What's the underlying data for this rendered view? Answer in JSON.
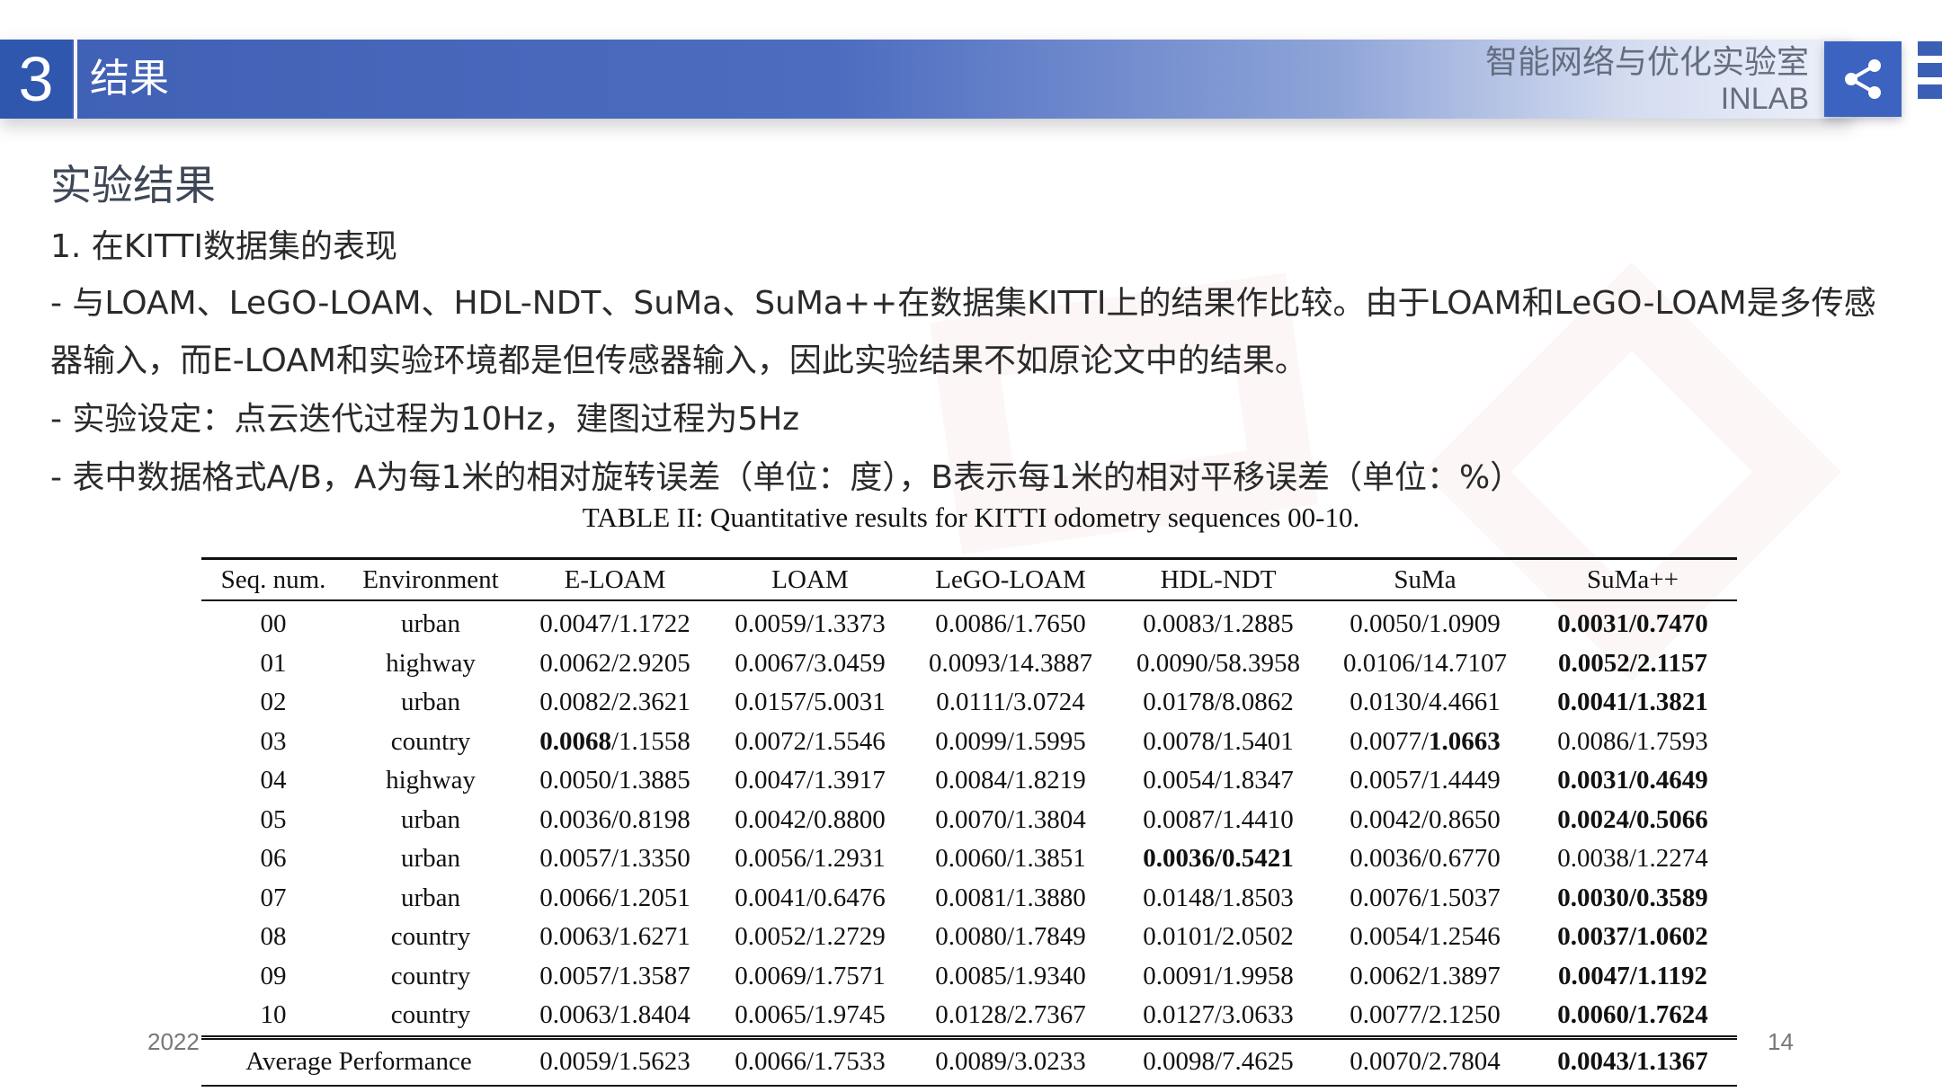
{
  "header": {
    "section_number": "3",
    "section_title": "结果",
    "lab_name": "智能网络与优化实验室",
    "lab_abbr": "INLAB",
    "icons": [
      "share-icon"
    ],
    "accent_color": "#3f60b4"
  },
  "content": {
    "heading": "实验结果",
    "subheading": "1. 在KITTI数据集的表现",
    "para1_line1": "- 与LOAM、LeGO-LOAM、HDL-NDT、SuMa、SuMa++在数据集KITTI上的结果作比较。由于LOAM和LeGO-LOAM是多传感",
    "para1_line2": "器输入，而E-LOAM和实验环境都是但传感器输入，因此实验结果不如原论文中的结果。",
    "para2": "- 实验设定：点云迭代过程为10Hz，建图过程为5Hz",
    "para3": "- 表中数据格式A/B，A为每1米的相对旋转误差（单位：度），B表示每1米的相对平移误差（单位：%）"
  },
  "table": {
    "caption": "TABLE II: Quantitative results for KITTI odometry sequences 00-10.",
    "headers": [
      "Seq. num.",
      "Environment",
      "E-LOAM",
      "LOAM",
      "LeGO-LOAM",
      "HDL-NDT",
      "SuMa",
      "SuMa++"
    ],
    "rows": [
      [
        "00",
        "urban",
        "0.0047/1.1722",
        "0.0059/1.3373",
        "0.0086/1.7650",
        "0.0083/1.2885",
        "0.0050/1.0909",
        "0.0031/0.7470"
      ],
      [
        "01",
        "highway",
        "0.0062/2.9205",
        "0.0067/3.0459",
        "0.0093/14.3887",
        "0.0090/58.3958",
        "0.0106/14.7107",
        "0.0052/2.1157"
      ],
      [
        "02",
        "urban",
        "0.0082/2.3621",
        "0.0157/5.0031",
        "0.0111/3.0724",
        "0.0178/8.0862",
        "0.0130/4.4661",
        "0.0041/1.3821"
      ],
      [
        "03",
        "country",
        "0.0068/1.1558",
        "0.0072/1.5546",
        "0.0099/1.5995",
        "0.0078/1.5401",
        "0.0077/1.0663",
        "0.0086/1.7593"
      ],
      [
        "04",
        "highway",
        "0.0050/1.3885",
        "0.0047/1.3917",
        "0.0084/1.8219",
        "0.0054/1.8347",
        "0.0057/1.4449",
        "0.0031/0.4649"
      ],
      [
        "05",
        "urban",
        "0.0036/0.8198",
        "0.0042/0.8800",
        "0.0070/1.3804",
        "0.0087/1.4410",
        "0.0042/0.8650",
        "0.0024/0.5066"
      ],
      [
        "06",
        "urban",
        "0.0057/1.3350",
        "0.0056/1.2931",
        "0.0060/1.3851",
        "0.0036/0.5421",
        "0.0036/0.6770",
        "0.0038/1.2274"
      ],
      [
        "07",
        "urban",
        "0.0066/1.2051",
        "0.0041/0.6476",
        "0.0081/1.3880",
        "0.0148/1.8503",
        "0.0076/1.5037",
        "0.0030/0.3589"
      ],
      [
        "08",
        "country",
        "0.0063/1.6271",
        "0.0052/1.2729",
        "0.0080/1.7849",
        "0.0101/2.0502",
        "0.0054/1.2546",
        "0.0037/1.0602"
      ],
      [
        "09",
        "country",
        "0.0057/1.3587",
        "0.0069/1.7571",
        "0.0085/1.9340",
        "0.0091/1.9958",
        "0.0062/1.3897",
        "0.0047/1.1192"
      ],
      [
        "10",
        "country",
        "0.0063/1.8404",
        "0.0065/1.9745",
        "0.0128/2.7367",
        "0.0127/3.0633",
        "0.0077/2.1250",
        "0.0060/1.7624"
      ]
    ],
    "average_label": "Average Performance",
    "average": [
      "0.0059/1.5623",
      "0.0066/1.7533",
      "0.0089/3.0233",
      "0.0098/7.4625",
      "0.0070/2.7804",
      "0.0043/1.1367"
    ]
  },
  "footer": {
    "year": "2022",
    "page_number": "14"
  }
}
